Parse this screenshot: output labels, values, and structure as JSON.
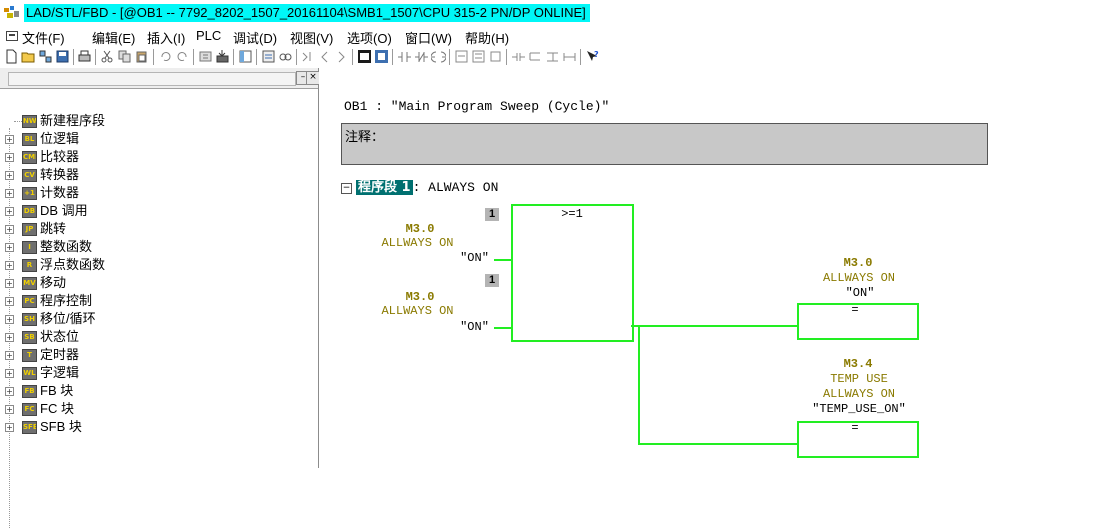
{
  "window": {
    "title": "LAD/STL/FBD  - [@OB1 -- 7792_8202_1507_20161104\\SMB1_1507\\CPU 315-2 PN/DP  ONLINE]"
  },
  "menu": {
    "items": [
      "文件(F)",
      "编辑(E)",
      "插入(I)",
      "PLC",
      "调试(D)",
      "视图(V)",
      "选项(O)",
      "窗口(W)",
      "帮助(H)"
    ]
  },
  "toolbar": {
    "icons": [
      "new-icon",
      "open-icon",
      "accessible-nodes-icon",
      "save-icon",
      "print-icon",
      "cut-icon",
      "copy-icon",
      "paste-icon",
      "undo-icon",
      "redo-icon",
      "load-icon",
      "download-icon",
      "overview-icon",
      "program-elements-icon",
      "monitor-icon",
      "breakpoint-icon",
      "previous-icon",
      "next-icon",
      "network-icon",
      "function-box-icon",
      "contact-icon",
      "normally-closed-icon",
      "coil-icon",
      "branch-open-icon",
      "branch-close-icon",
      "help-icon"
    ]
  },
  "tree": {
    "items": [
      {
        "label": "新建程序段",
        "icon": "new-network-icon",
        "glyph": "NW"
      },
      {
        "label": "位逻辑",
        "icon": "bit-logic-icon",
        "glyph": "BL"
      },
      {
        "label": "比较器",
        "icon": "comparator-icon",
        "glyph": "CMP"
      },
      {
        "label": "转换器",
        "icon": "converter-icon",
        "glyph": "CV"
      },
      {
        "label": "计数器",
        "icon": "counter-icon",
        "glyph": "+1"
      },
      {
        "label": "DB 调用",
        "icon": "db-call-icon",
        "glyph": "DB"
      },
      {
        "label": "跳转",
        "icon": "jump-icon",
        "glyph": "JP"
      },
      {
        "label": "整数函数",
        "icon": "integer-function-icon",
        "glyph": "I"
      },
      {
        "label": "浮点数函数",
        "icon": "float-function-icon",
        "glyph": "R"
      },
      {
        "label": "移动",
        "icon": "move-icon",
        "glyph": "MV"
      },
      {
        "label": "程序控制",
        "icon": "program-control-icon",
        "glyph": "PC"
      },
      {
        "label": "移位/循环",
        "icon": "shift-rotate-icon",
        "glyph": "SH"
      },
      {
        "label": "状态位",
        "icon": "status-bit-icon",
        "glyph": "SB"
      },
      {
        "label": "定时器",
        "icon": "timer-icon",
        "glyph": "T"
      },
      {
        "label": "字逻辑",
        "icon": "word-logic-icon",
        "glyph": "WL"
      },
      {
        "label": "FB 块",
        "icon": "fb-block-icon",
        "glyph": "FB"
      },
      {
        "label": "FC 块",
        "icon": "fc-block-icon",
        "glyph": "FC"
      },
      {
        "label": "SFB 块",
        "icon": "sfb-block-icon",
        "glyph": "SFB"
      }
    ]
  },
  "editor": {
    "block_title": "OB1 :  \"Main Program Sweep (Cycle)\"",
    "comment_label": "注释：",
    "network": {
      "label": "程序段 1",
      "title": ": ALWAYS ON",
      "or_box": {
        "operator": ">=1",
        "pin1": "1",
        "pin2": "1"
      },
      "input1": {
        "address": "M3.0",
        "comment": "ALLWAYS ON",
        "symbol": "\"ON\""
      },
      "input2": {
        "address": "M3.0",
        "comment": "ALLWAYS ON",
        "symbol": "\"ON\""
      },
      "coil1": {
        "address": "M3.0",
        "comment": "ALLWAYS ON",
        "symbol": "\"ON\"",
        "operator": "="
      },
      "coil2": {
        "address": "M3.4",
        "comment1": "TEMP USE",
        "comment2": "ALLWAYS ON",
        "symbol": "\"TEMP_USE_ON\"",
        "operator": "="
      }
    }
  },
  "colors": {
    "title_highlight": "#00f7f7",
    "active_wire": "#22ee22",
    "network_label_bg": "#007070",
    "operand": "#8a7a00",
    "comment_bg": "#c8c8c8"
  }
}
